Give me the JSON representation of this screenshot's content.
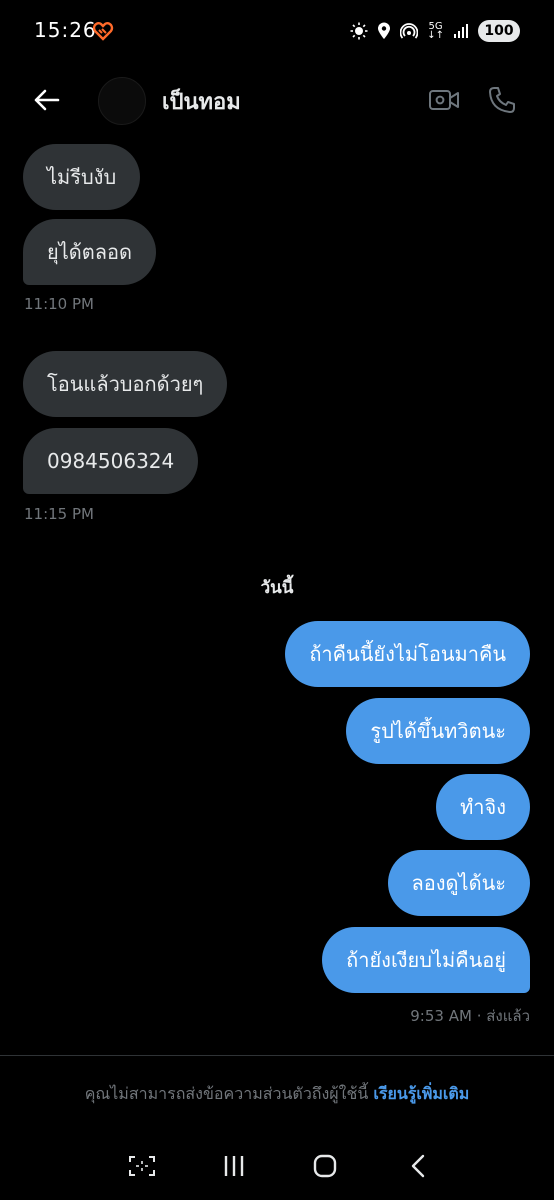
{
  "status_bar": {
    "time": "15:26",
    "network": "5G",
    "battery": "100"
  },
  "header": {
    "contact_name": "เป็นทอม",
    "icons": {
      "back": "arrow-left-icon",
      "video": "video-camera-icon",
      "call": "phone-icon"
    }
  },
  "messages": [
    {
      "direction": "in",
      "text": "ไม่รีบงับ"
    },
    {
      "direction": "in",
      "text": "ยุได้ตลอด"
    },
    {
      "direction": "in",
      "text": "โอนแล้วบอกด้วยๆ"
    },
    {
      "direction": "in",
      "text": "0984506324"
    },
    {
      "direction": "out",
      "text": "ถ้าคืนนี้ยังไม่โอนมาคืน"
    },
    {
      "direction": "out",
      "text": "รูปได้ขึ้นทวิตนะ"
    },
    {
      "direction": "out",
      "text": "ทำจิง"
    },
    {
      "direction": "out",
      "text": "ลองดูได้นะ"
    },
    {
      "direction": "out",
      "text": "ถ้ายังเงียบไม่คืนอยู่"
    }
  ],
  "timestamps": {
    "t1": "11:10 PM",
    "t2": "11:15 PM",
    "t3": "9:53 AM · ส่งแล้ว"
  },
  "date_divider": "วันนี้",
  "notice": {
    "text": "คุณไม่สามารถส่งข้อความส่วนตัวถึงผู้ใช้นี้ ",
    "link": "เรียนรู้เพิ่มเติม"
  },
  "colors": {
    "background": "#000000",
    "incoming_bubble": "#2f3336",
    "outgoing_bubble": "#4a99e9",
    "secondary_text": "#71767b",
    "link": "#4a99e9"
  }
}
